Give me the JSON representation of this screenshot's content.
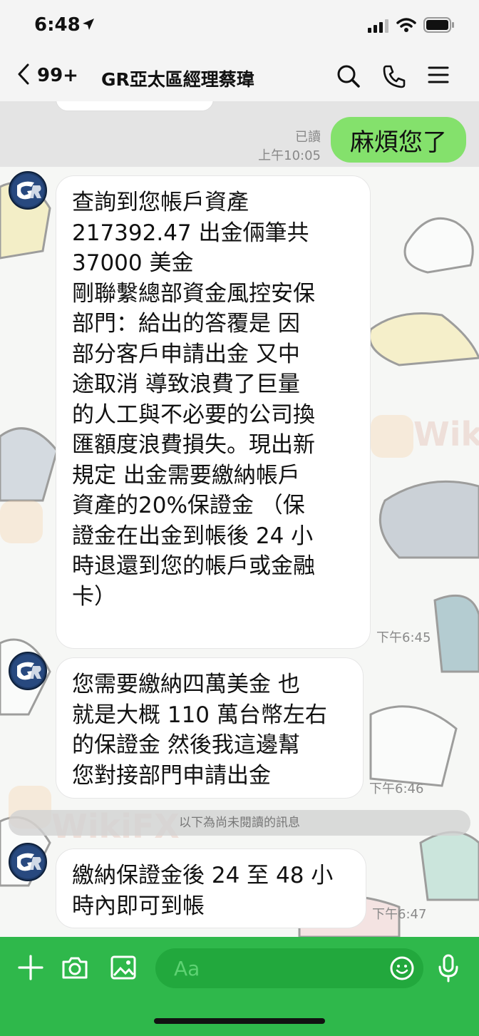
{
  "status_bar": {
    "time": "6:48"
  },
  "header": {
    "back_count": "99+",
    "title": "GR亞太區經理蔡瑋",
    "icons": [
      "search-icon",
      "phone-icon",
      "menu-icon"
    ]
  },
  "sent": {
    "read_label": "已讀",
    "time": "上午10:05",
    "text": "麻煩您了"
  },
  "messages": [
    {
      "text": "查詢到您帳戶資產\n217392.47 出金倆筆共\n37000 美金\n剛聯繫總部資金風控安保\n部門：給出的答覆是 因\n部分客戶申請出金 又中\n途取消 導致浪費了巨量\n的人工與不必要的公司換\n匯額度浪費損失。現出新\n規定 出金需要繳納帳戶\n資產的20%保證金 （保\n證金在出金到帳後 24 小\n時退還到您的帳戶或金融\n卡）",
      "time": "下午6:45"
    },
    {
      "text": "您需要繳納四萬美金 也\n就是大概 110 萬台幣左右\n的保證金 然後我這邊幫\n您對接部門申請出金",
      "time": "下午6:46"
    },
    {
      "text": "繳納保證金後 24 至 48 小\n時內即可到帳",
      "time": "下午6:47"
    }
  ],
  "unread_divider": "以下為尚未閱讀的訊息",
  "watermark": "WikiFX",
  "input_bar": {
    "placeholder": "Aa",
    "icons": [
      "plus-icon",
      "camera-icon",
      "image-icon",
      "emoji-icon",
      "microphone-icon"
    ]
  },
  "colors": {
    "sent_bubble": "#84e16c",
    "input_bar": "#2fb84b",
    "avatar": "#1e3a66"
  }
}
